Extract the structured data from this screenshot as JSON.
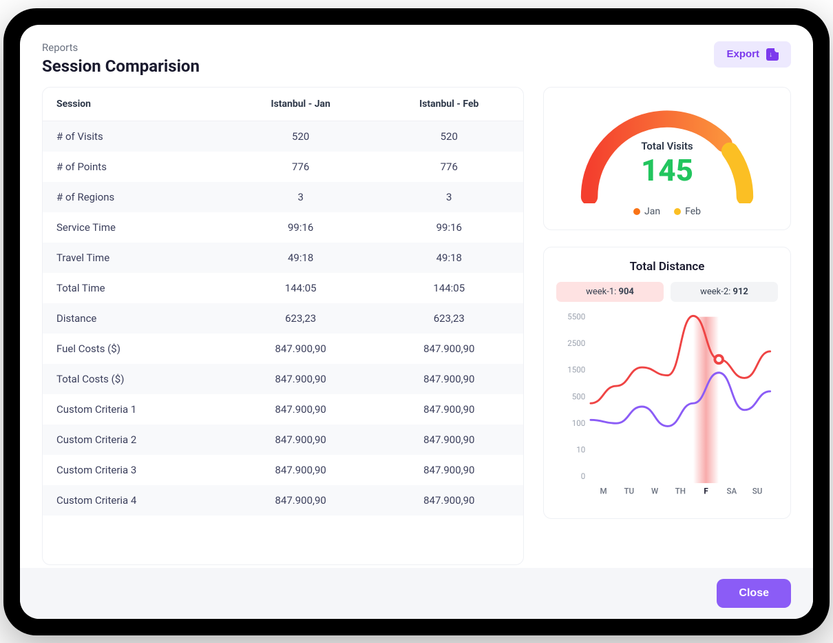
{
  "breadcrumb": "Reports",
  "title": "Session Comparision",
  "export_label": "Export",
  "close_label": "Close",
  "table": {
    "headers": [
      "Session",
      "Istanbul - Jan",
      "Istanbul - Feb"
    ],
    "rows": [
      {
        "label": "# of Visits",
        "jan": "520",
        "feb": "520"
      },
      {
        "label": "# of Points",
        "jan": "776",
        "feb": "776"
      },
      {
        "label": "# of Regions",
        "jan": "3",
        "feb": "3"
      },
      {
        "label": "Service Time",
        "jan": "99:16",
        "feb": "99:16"
      },
      {
        "label": "Travel Time",
        "jan": "49:18",
        "feb": "49:18"
      },
      {
        "label": "Total Time",
        "jan": "144:05",
        "feb": "144:05"
      },
      {
        "label": "Distance",
        "jan": "623,23",
        "feb": "623,23"
      },
      {
        "label": "Fuel Costs ($)",
        "jan": "847.900,90",
        "feb": "847.900,90"
      },
      {
        "label": "Total Costs ($)",
        "jan": "847.900,90",
        "feb": "847.900,90"
      },
      {
        "label": "Custom Criteria 1",
        "jan": "847.900,90",
        "feb": "847.900,90"
      },
      {
        "label": "Custom Criteria 2",
        "jan": "847.900,90",
        "feb": "847.900,90"
      },
      {
        "label": "Custom Criteria 3",
        "jan": "847.900,90",
        "feb": "847.900,90"
      },
      {
        "label": "Custom Criteria 4",
        "jan": "847.900,90",
        "feb": "847.900,90"
      }
    ]
  },
  "gauge": {
    "title": "Total Visits",
    "value": "145",
    "legend": [
      {
        "label": "Jan",
        "color": "#f97316"
      },
      {
        "label": "Feb",
        "color": "#fbbf24"
      }
    ]
  },
  "distance": {
    "title": "Total Distance",
    "week1_label": "week-1:",
    "week1_value": "904",
    "week2_label": "week-2:",
    "week2_value": "912"
  },
  "chart_data": [
    {
      "type": "gauge",
      "title": "Total Visits",
      "value": 145,
      "segments": [
        {
          "name": "Jan",
          "color": "#f97316",
          "fraction": 0.78
        },
        {
          "name": "Feb",
          "color": "#fbbf24",
          "fraction": 0.22
        }
      ]
    },
    {
      "type": "line",
      "title": "Total Distance",
      "x": [
        "M",
        "TU",
        "W",
        "TH",
        "F",
        "SA",
        "SU"
      ],
      "y_ticks": [
        0,
        10,
        100,
        500,
        1500,
        2500,
        5500
      ],
      "series": [
        {
          "name": "week-1",
          "total": 904,
          "color": "#ef4444",
          "values": [
            400,
            900,
            1600,
            1300,
            5600,
            1900,
            1200,
            2200
          ]
        },
        {
          "name": "week-2",
          "total": 912,
          "color": "#8b5cf6",
          "values": [
            150,
            100,
            350,
            90,
            400,
            1400,
            300,
            700
          ]
        }
      ],
      "highlight_index": 4,
      "highlight_value_series0": 1900
    }
  ]
}
